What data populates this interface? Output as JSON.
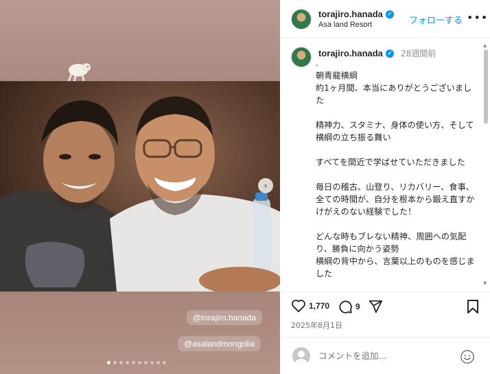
{
  "post": {
    "username": "torajiro.hanada",
    "location": "Asa land Resort",
    "follow_label": "フォローする",
    "more_label": "•••",
    "time_ago": "28週間前",
    "caption": ".\n朝青龍横綱\n約1ヶ月間、本当にありがとうございました\n\n精神力、スタミナ、身体の使い方、そして横綱の立ち振る舞い\n\nすべてを間近で学ばせていただきました\n\n毎日の稽古、山登り、リカバリー、食事、全ての時間が、自分を根本から鍛え直すかけがえのない経験でした！\n\nどんな時もブレない精神、周囲への気配り、勝負に向かう姿勢\n横綱の背中から、言葉以上のものを感じました\n\nまだまだ未熟ですが、ここで学んだこ",
    "likes": "1,770",
    "comments": "9",
    "date": "2025年8月1日"
  },
  "media": {
    "mentions": [
      "@torajiro.hanada",
      "@asalandmongolia"
    ],
    "next_glyph": "›",
    "slide_count": 10,
    "active_slide": 0
  },
  "comment": {
    "placeholder": "コメントを追加..."
  },
  "colors": {
    "accent": "#0095f6",
    "text": "#262626",
    "muted": "#8e8e8e"
  },
  "icons": [
    "heart-icon",
    "comment-icon",
    "share-icon",
    "bookmark-icon",
    "emoji-icon",
    "verified-icon",
    "chevron-right-icon"
  ]
}
